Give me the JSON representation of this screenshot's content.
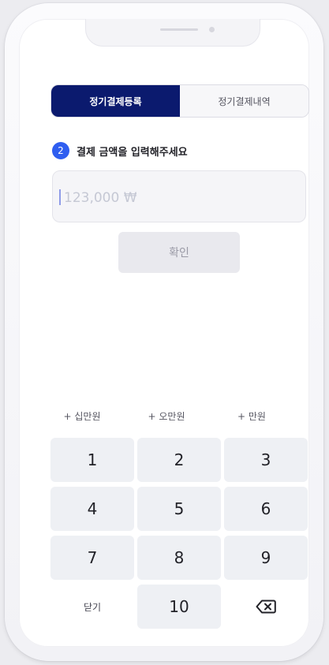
{
  "tabs": {
    "register": "정기결제등록",
    "history": "정기결제내역"
  },
  "step": {
    "number": "2",
    "text": "결제 금액을 입력해주세요"
  },
  "amount": {
    "placeholder": "123,000 ₩",
    "value": ""
  },
  "confirm_label": "확인",
  "quick_add": [
    "+ 십만원",
    "+ 오만원",
    "+ 만원"
  ],
  "keypad": {
    "keys": [
      "1",
      "2",
      "3",
      "4",
      "5",
      "6",
      "7",
      "8",
      "9"
    ],
    "close": "닫기",
    "ten": "10",
    "backspace_icon": "backspace-icon"
  },
  "colors": {
    "accent": "#0b1a6e",
    "step_badge": "#2f5ef0"
  }
}
